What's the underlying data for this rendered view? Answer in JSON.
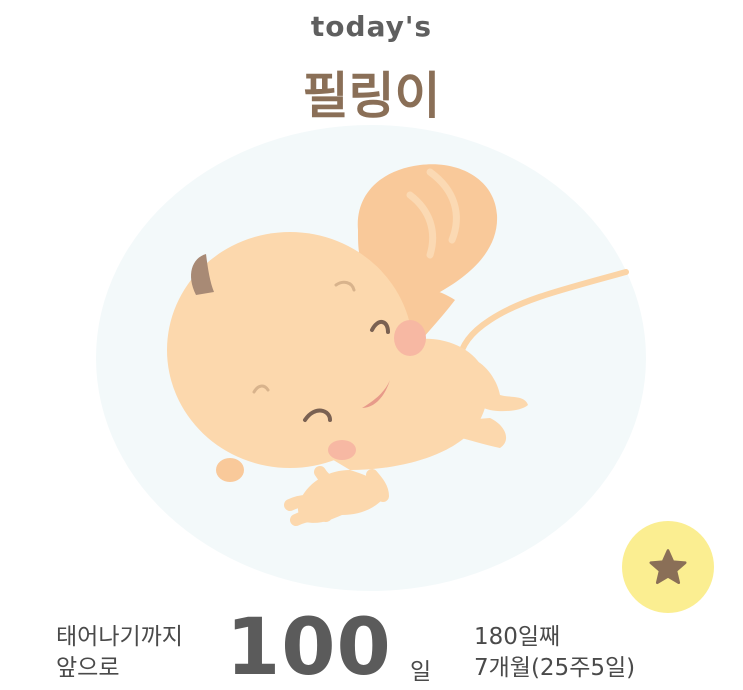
{
  "header": {
    "subtitle": "today's",
    "title": "필링이"
  },
  "illustration": {
    "name": "baby-illustration",
    "background_color": "#f4fafb",
    "skin_color": "#fcd8ad",
    "blush_color": "#f7b8a3"
  },
  "star_button": {
    "icon": "star-icon",
    "bg_color": "#fbee91",
    "icon_color": "#8a6f57"
  },
  "countdown": {
    "line1": "태어나기까지",
    "line2": "앞으로",
    "days_remaining": "100",
    "unit": "일"
  },
  "progress": {
    "day_count": "180일째",
    "month_week": "7개월(25주5일)"
  }
}
